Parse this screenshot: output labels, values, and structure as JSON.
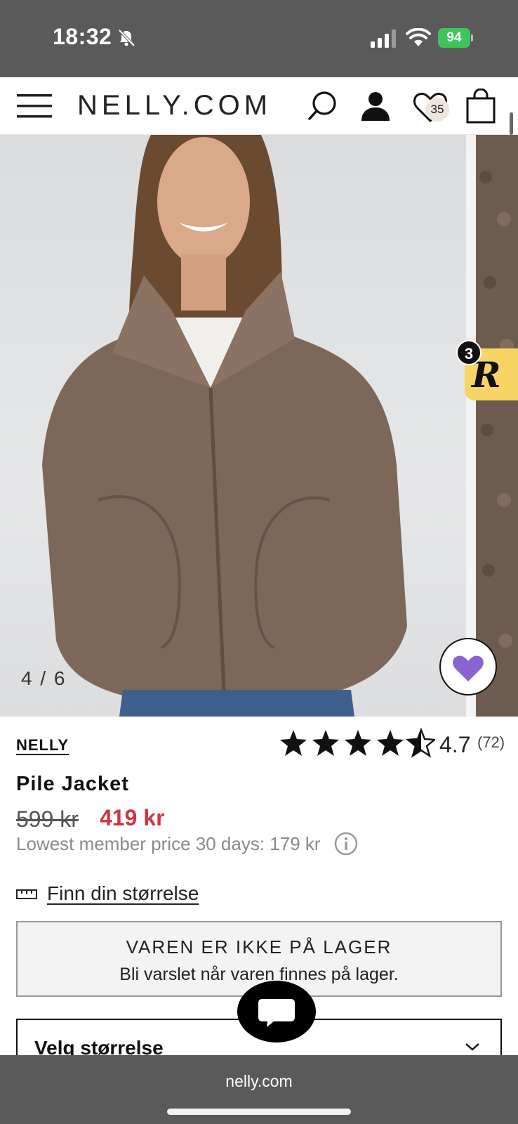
{
  "status_bar": {
    "time": "18:32",
    "battery": "94",
    "icons": [
      "bell-muted-icon",
      "signal-icon",
      "wifi-icon",
      "battery-charging-icon"
    ]
  },
  "header": {
    "logo": "NELLY.COM",
    "wishlist_count": "35",
    "icons": [
      "menu-icon",
      "search-icon",
      "account-icon",
      "heart-icon",
      "bag-icon"
    ]
  },
  "gallery": {
    "counter": "4 / 6",
    "reward_badge_count": "3",
    "reward_letter": "R"
  },
  "product": {
    "brand": "NELLY",
    "rating": {
      "value": "4.7",
      "count": "(72)",
      "stars": 4.7,
      "max": 5
    },
    "title": "Pile Jacket",
    "old_price": "599 kr",
    "new_price": "419 kr",
    "lowest_price_note": "Lowest member price 30 days: 179 kr",
    "size_guide": "Finn din størrelse",
    "stock": {
      "title": "VAREN ER IKKE PÅ LAGER",
      "subtitle": "Bli varslet når varen finnes på lager."
    },
    "size_select_label": "Velg størrelse"
  },
  "colors": {
    "sale_price": "#d1343c",
    "heart_fill": "#8a63d2",
    "reward_bg": "#f7d463",
    "battery": "#3ec45a"
  },
  "browser": {
    "url": "nelly.com"
  }
}
